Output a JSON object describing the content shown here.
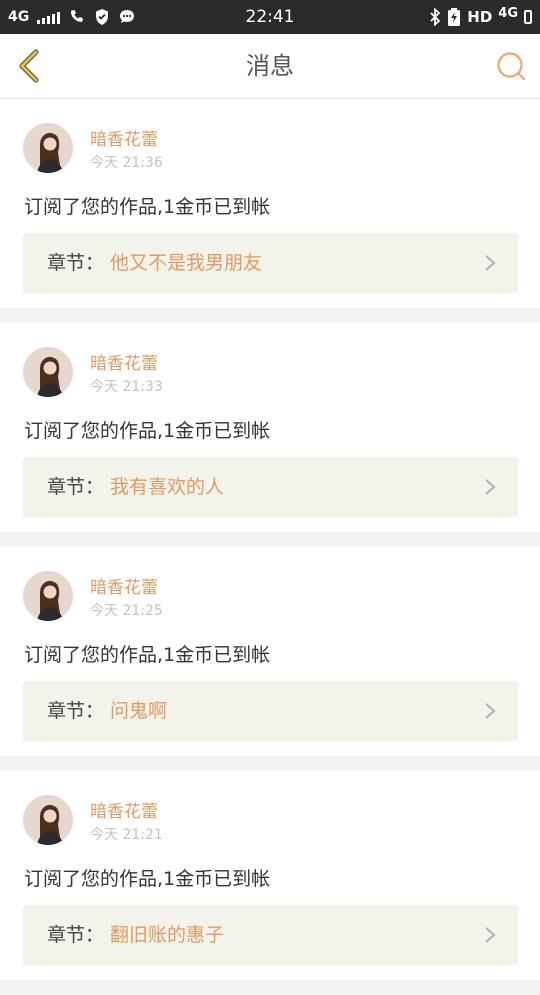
{
  "status_bar": {
    "network_left": "4G",
    "time": "22:41",
    "hd_label": "HD",
    "network_right": "4G"
  },
  "header": {
    "title": "消息"
  },
  "colors": {
    "accent": "#e49a62",
    "back_icon": "#c9a227",
    "chapter_bg": "#f2f3ea"
  },
  "icons": {
    "back": "chevron-left-icon",
    "search": "search-icon",
    "chevron": "chevron-right-icon"
  },
  "messages": [
    {
      "author": "暗香花蕾",
      "time": "今天 21:36",
      "text": "订阅了您的作品,1金币已到帐",
      "chapter_label": "章节：",
      "chapter_title": "他又不是我男朋友"
    },
    {
      "author": "暗香花蕾",
      "time": "今天 21:33",
      "text": "订阅了您的作品,1金币已到帐",
      "chapter_label": "章节：",
      "chapter_title": "我有喜欢的人"
    },
    {
      "author": "暗香花蕾",
      "time": "今天 21:25",
      "text": "订阅了您的作品,1金币已到帐",
      "chapter_label": "章节：",
      "chapter_title": "问鬼啊"
    },
    {
      "author": "暗香花蕾",
      "time": "今天 21:21",
      "text": "订阅了您的作品,1金币已到帐",
      "chapter_label": "章节：",
      "chapter_title": "翻旧账的惠子"
    }
  ]
}
